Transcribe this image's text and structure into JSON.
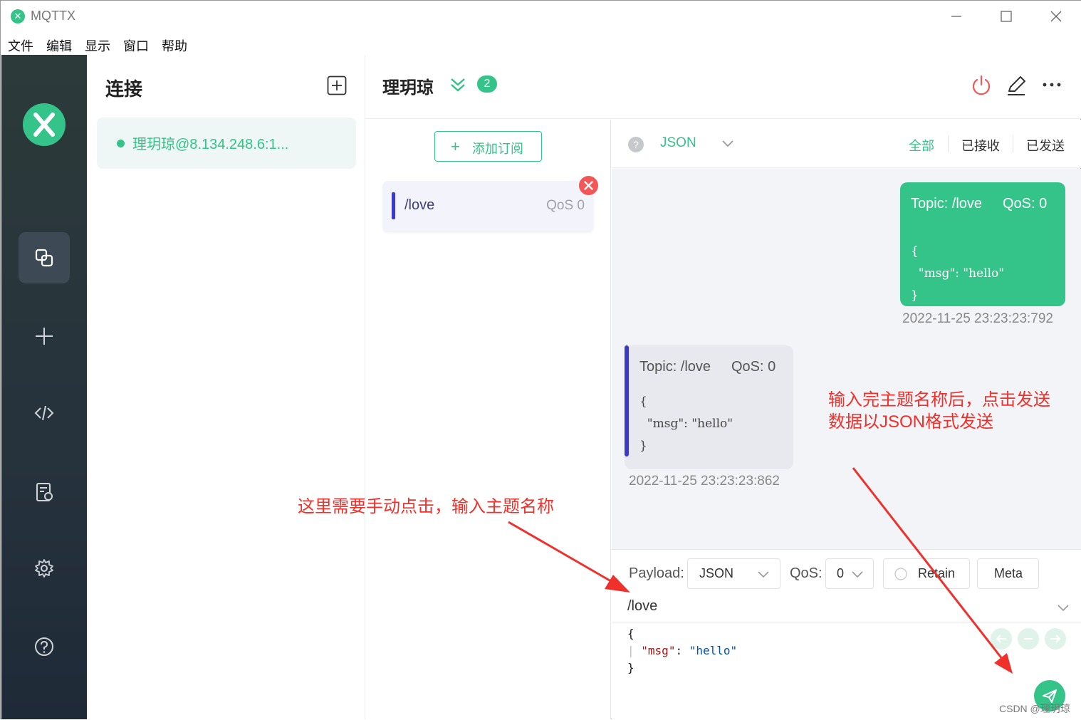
{
  "window": {
    "title": "MQTTX",
    "logo_glyph": "✕",
    "controls": [
      "minimize-icon",
      "maximize-icon",
      "close-icon"
    ]
  },
  "menubar": [
    "文件",
    "编辑",
    "显示",
    "窗口",
    "帮助"
  ],
  "nav": {
    "items": [
      {
        "name": "connections",
        "icon": "connections-icon",
        "active": true
      },
      {
        "name": "new-connection",
        "icon": "plus-icon",
        "active": false
      },
      {
        "name": "script",
        "icon": "code-icon",
        "active": false
      },
      {
        "name": "log",
        "icon": "log-icon",
        "active": false
      },
      {
        "name": "settings",
        "icon": "gear-icon",
        "active": false
      },
      {
        "name": "help",
        "icon": "help-icon",
        "active": false
      }
    ]
  },
  "connections": {
    "title": "连接",
    "items": [
      {
        "name": "理玥琼@8.134.248.6:1...",
        "status": "connected"
      }
    ]
  },
  "header": {
    "title": "理玥琼",
    "badge_count": "2"
  },
  "subscriptions": {
    "add_label": "添加订阅",
    "items": [
      {
        "topic": "/love",
        "qos": "QoS 0",
        "color": "#3d3ac7"
      }
    ]
  },
  "message_bar": {
    "help_glyph": "?",
    "format": "JSON",
    "filters": [
      "全部",
      "已接收",
      "已发送"
    ],
    "active_filter": "全部"
  },
  "messages": [
    {
      "direction": "sent",
      "topic": "Topic: /love",
      "qos": "QoS: 0",
      "payload": "{\n  \"msg\": \"hello\"\n}",
      "time": "2022-11-25 23:23:23:792"
    },
    {
      "direction": "received",
      "topic": "Topic: /love",
      "qos": "QoS: 0",
      "payload": "{\n  \"msg\": \"hello\"\n}",
      "time": "2022-11-25 23:23:23:862"
    }
  ],
  "composer": {
    "payload_label": "Payload:",
    "payload_format": "JSON",
    "qos_label": "QoS:",
    "qos_value": "0",
    "retain_label": "Retain",
    "meta_label": "Meta",
    "topic": "/love",
    "editor_open": "{",
    "editor_key": "\"msg\"",
    "editor_colon": ": ",
    "editor_value": "\"hello\"",
    "editor_close": "}"
  },
  "annotations": {
    "right_line1": "输入完主题名称后，点击发送",
    "right_line2": "数据以JSON格式发送",
    "left": "这里需要手动点击，输入主题名称"
  },
  "watermark": "CSDN @理玥琼",
  "colors": {
    "accent": "#34c388",
    "topic": "#3d3ac7",
    "annotation": "#f0302a",
    "danger": "#f25656"
  }
}
